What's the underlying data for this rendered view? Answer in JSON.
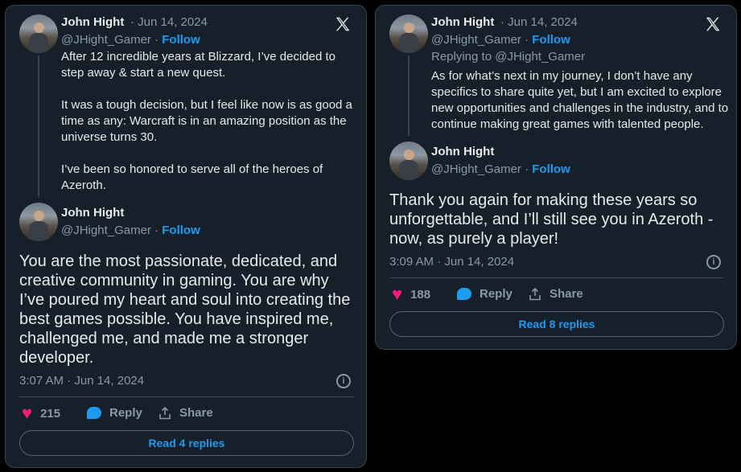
{
  "tweet1": {
    "author": "John Hight",
    "date": "· Jun 14, 2024",
    "handle": "@JHight_Gamer ·",
    "follow": "Follow",
    "reply_text": "After 12 incredible years at Blizzard, I’ve decided to step away & start a new quest.\n\nIt was a tough decision, but I feel like now is as good a time as any: Warcraft is in an amazing position as the universe turns 30.\n\nI’ve been so honored to serve all of the heroes of Azeroth.",
    "main_author": "John Hight",
    "main_handle": "@JHight_Gamer ·",
    "main_text": "You are the most passionate, dedicated, and creative community in gaming. You are why I’ve poured my heart and soul into creating the best games possible. You have inspired me, challenged me, and made me a stronger developer.",
    "timestamp": "3:07 AM · Jun 14, 2024",
    "likes": "215",
    "reply_label": "Reply",
    "share_label": "Share",
    "read_replies": "Read 4 replies"
  },
  "tweet2": {
    "author": "John Hight",
    "date": "· Jun 14, 2024",
    "handle": "@JHight_Gamer ·",
    "follow": "Follow",
    "replying_to": "Replying to @JHight_Gamer",
    "reply_text": "As for what’s next in my journey, I don’t have any specifics to share quite yet, but I am excited to explore new opportunities and challenges in the industry, and to continue making great games with talented people.",
    "main_author": "John Hight",
    "main_handle": "@JHight_Gamer ·",
    "main_text": "Thank you again for making these years so unforgettable, and I’ll still see you in Azeroth - now, as purely a player!",
    "timestamp": "3:09 AM · Jun 14, 2024",
    "likes": "188",
    "reply_label": "Reply",
    "share_label": "Share",
    "read_replies": "Read 8 replies"
  },
  "icons": {
    "x_logo": "x-logo-icon",
    "info": "info-icon",
    "like": "heart-icon",
    "reply": "reply-bubble-icon",
    "share": "share-icon"
  },
  "colors": {
    "card_bg": "#15202b",
    "accent": "#1d9bf0",
    "like": "#f91880",
    "muted": "#8b98a5"
  }
}
